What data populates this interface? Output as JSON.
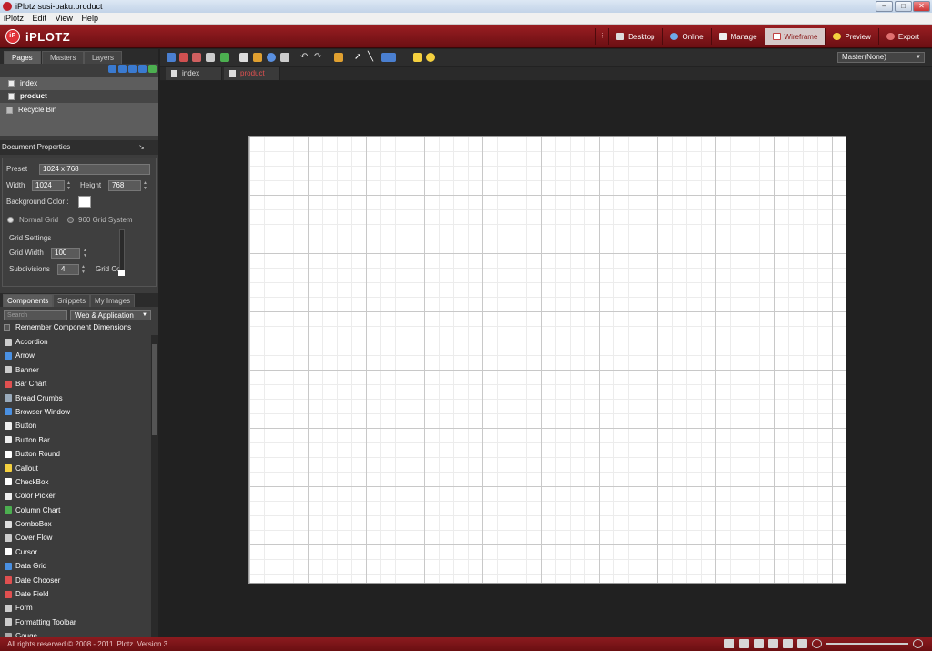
{
  "window": {
    "title": "iPlotz  susi-paku:product",
    "buttons": [
      "–",
      "□",
      "✕"
    ]
  },
  "menu": [
    "iPlotz",
    "Edit",
    "View",
    "Help"
  ],
  "app": {
    "logo": "iPLOTZ",
    "modes": [
      {
        "label": "Desktop",
        "icon": "desktop-icon",
        "color": "#dddddd"
      },
      {
        "label": "Online",
        "icon": "online-icon",
        "color": "#6fa8e8"
      },
      {
        "label": "Manage",
        "icon": "manage-icon",
        "color": "#eeeeee"
      },
      {
        "label": "Wireframe",
        "icon": "wireframe-icon",
        "color": "#c04040",
        "active": true
      },
      {
        "label": "Preview",
        "icon": "preview-icon",
        "color": "#f4d03f"
      },
      {
        "label": "Export",
        "icon": "export-icon",
        "color": "#e07070"
      }
    ]
  },
  "panel": {
    "tabs": [
      "Pages",
      "Masters",
      "Layers"
    ],
    "pages": [
      "index",
      "product",
      "Recycle Bin"
    ],
    "doc_properties": {
      "title": "Document Properties",
      "preset_label": "Preset",
      "preset_value": "1024 x 768",
      "width_label": "Width",
      "width_value": "1024",
      "height_label": "Height",
      "height_value": "768",
      "bg_label": "Background Color :",
      "normal_grid": "Normal Grid",
      "grid960": "960 Grid System",
      "grid_settings": "Grid Settings",
      "grid_width_label": "Grid Width",
      "grid_width_value": "100",
      "subdiv_label": "Subdivisions",
      "subdiv_value": "4",
      "grid_color_label": "Grid Co"
    }
  },
  "components": {
    "tabs": [
      "Components",
      "Snippets",
      "My Images"
    ],
    "search_placeholder": "Search",
    "filter": "Web & Application",
    "remember": "Remember Component Dimensions",
    "items": [
      "Accordion",
      "Arrow",
      "Banner",
      "Bar Chart",
      "Bread Crumbs",
      "Browser Window",
      "Button",
      "Button Bar",
      "Button Round",
      "Callout",
      "CheckBox",
      "Color Picker",
      "Column Chart",
      "ComboBox",
      "Cover Flow",
      "Cursor",
      "Data Grid",
      "Date Chooser",
      "Date Field",
      "Form",
      "Formatting Toolbar",
      "Gauge"
    ]
  },
  "toolbar": {
    "master": "Master(None)"
  },
  "doc_tabs": [
    "index",
    "product"
  ],
  "status": {
    "text": "All rights reserved © 2008 - 2011 iPlotz. Version 3"
  }
}
